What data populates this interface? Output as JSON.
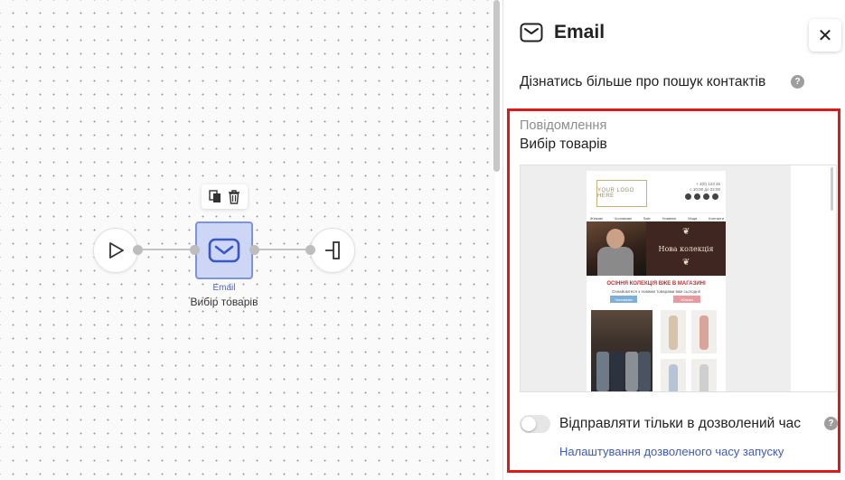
{
  "canvas": {
    "email_node": {
      "type_label": "Email",
      "name": "Вибір товарів",
      "icon": "envelope-icon"
    },
    "start_node_icon": "play-icon",
    "exit_node_icon": "exit-icon",
    "node_actions": [
      "copy-icon",
      "trash-icon"
    ]
  },
  "panel": {
    "title": "Email",
    "title_icon": "envelope-icon",
    "close_icon": "close-icon",
    "learn_more": "Дізнатись більше про пошук контактів",
    "message_label": "Повідомлення",
    "message_value": "Вибір товарів",
    "preview": {
      "logo": "YOUR LOGO HERE",
      "phone": "+ 3(0) 123 45",
      "hours": "с 10:00 до 22:00",
      "nav": [
        "Жінкам",
        "Чоловікам",
        "Sale",
        "Новинки",
        "Мода",
        "Контакти"
      ],
      "hero_text": "Нова колекція",
      "headline": "ОСІННЯ КОЛЕКЦІЯ ВЖЕ В МАГАЗИНІ",
      "subline": "Ознайомтеся з новими товарами вже сьогодні!",
      "button_left": "Чоловікам",
      "button_right": "Жінкам"
    },
    "toggle_label": "Відправляти тільки в дозволений час",
    "toggle_on": false,
    "settings_link": "Налаштування дозволеного часу запуску"
  },
  "colors": {
    "accent": "#4a62c9",
    "node_fill": "#cdd6f4",
    "highlight_border": "#e31818",
    "link": "#3d5bbf"
  }
}
